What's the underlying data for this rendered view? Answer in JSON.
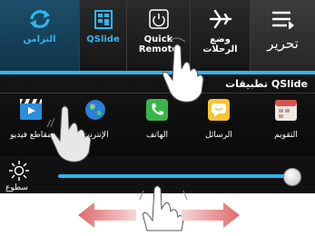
{
  "quick_settings": {
    "sync_label": "التزامن",
    "qslide_label": "QSlide",
    "quick_remote_label": "Quick\nRemote",
    "airplane_label": "وضع\nالرحلات",
    "edit_label": "تحرير"
  },
  "qslide_apps": {
    "title": "تطبيقات QSlide",
    "items": [
      {
        "label": "التقويم",
        "icon": "calendar-icon"
      },
      {
        "label": "الرسائل",
        "icon": "messages-icon"
      },
      {
        "label": "الهاتف",
        "icon": "phone-icon"
      },
      {
        "label": "الإنترنت",
        "icon": "internet-icon"
      },
      {
        "label": "مقاطع فيديو",
        "icon": "video-icon"
      }
    ]
  },
  "brightness": {
    "label": "سطوع",
    "level": 0.97
  },
  "colors": {
    "accent": "#2db7ef",
    "arrow": "#e06a6a"
  }
}
